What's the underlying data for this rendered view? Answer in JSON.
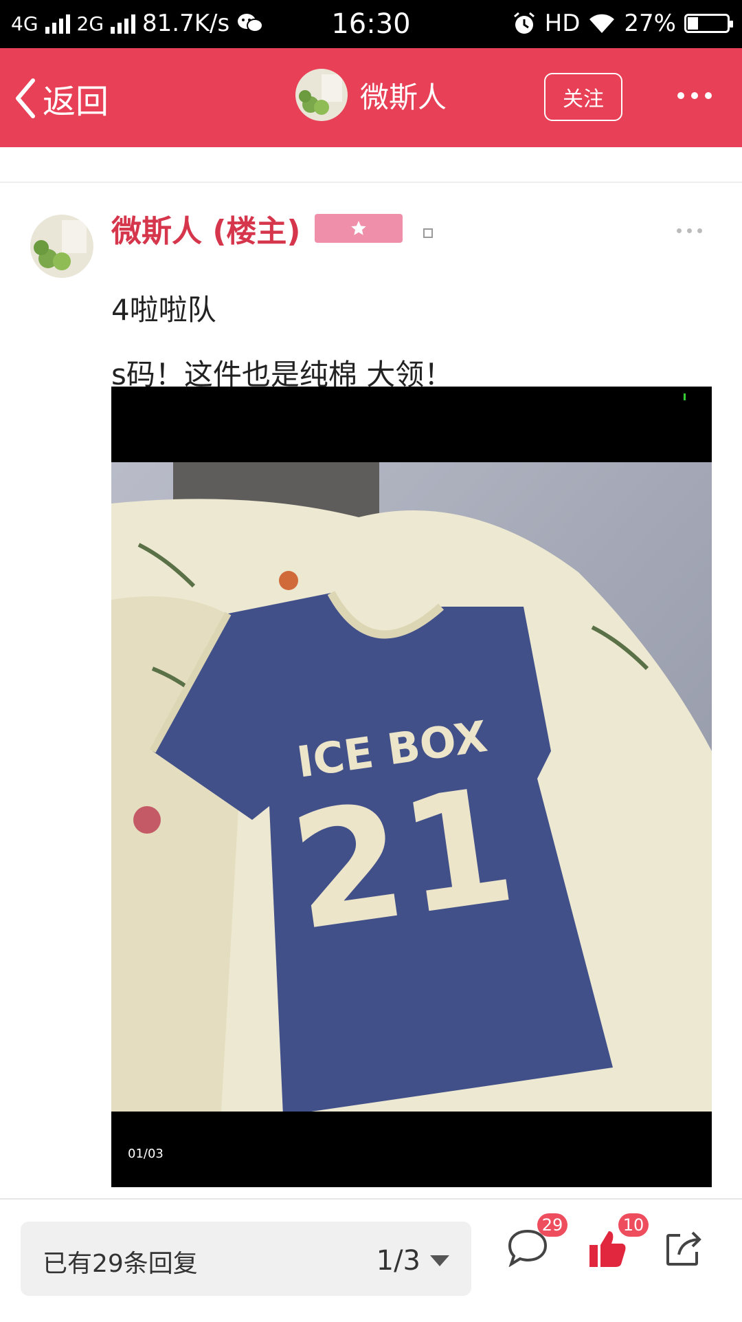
{
  "status_bar": {
    "network1": "4G",
    "network2": "2G",
    "speed": "81.7K/s",
    "time": "16:30",
    "hd": "HD",
    "battery_text": "27%",
    "battery_level": 0.27
  },
  "header": {
    "back_label": "返回",
    "title": "微斯人",
    "follow_label": "关注"
  },
  "post": {
    "author": "微斯人 (楼主)",
    "trailing_mark": "。",
    "lines": [
      "4啦啦队",
      "s码！这件也是纯棉 大领！"
    ],
    "image": {
      "counter": "01/03",
      "shirt_text_line1": "ICE  BOX",
      "shirt_text_line2": "21"
    }
  },
  "bottom_bar": {
    "reply_summary": "已有29条回复",
    "page_indicator": "1/3",
    "comment_count": "29",
    "like_count": "10"
  },
  "colors": {
    "accent": "#e84157",
    "author": "#d6364c",
    "badge": "#ee4d5e",
    "rank_badge": "#ef8fa9"
  },
  "icons": [
    "back-chevron-icon",
    "more-dots-icon",
    "star-icon",
    "comment-icon",
    "thumbs-up-icon",
    "share-icon",
    "wechat-icon",
    "alarm-icon",
    "wifi-icon",
    "battery-icon"
  ]
}
